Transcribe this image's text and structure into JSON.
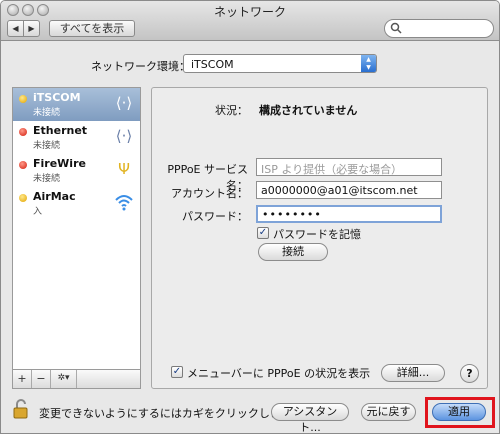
{
  "window": {
    "title": "ネットワーク"
  },
  "toolbar": {
    "back_label": "◀",
    "forward_label": "▶",
    "show_all_label": "すべてを表示"
  },
  "search": {
    "placeholder": ""
  },
  "location": {
    "label": "ネットワーク環境：",
    "value": "iTSCOM"
  },
  "sidebar": {
    "items": [
      {
        "name": "iTSCOM",
        "status": "未接続",
        "dot": "yellow",
        "icon": "pppoe-arrows-icon"
      },
      {
        "name": "Ethernet",
        "status": "未接続",
        "dot": "red",
        "icon": "ethernet-arrows-icon"
      },
      {
        "name": "FireWire",
        "status": "未接続",
        "dot": "red",
        "icon": "firewire-icon"
      },
      {
        "name": "AirMac",
        "status": "入",
        "dot": "yellow",
        "icon": "wifi-icon"
      }
    ],
    "tools": {
      "add": "+",
      "remove": "−",
      "action": "✲▾"
    }
  },
  "detail": {
    "status_label": "状況：",
    "status_value": "構成されていません",
    "pppoe_label": "PPPoE サービス名：",
    "pppoe_placeholder": "ISP より提供（必要な場合）",
    "account_label": "アカウント名：",
    "account_value": "a0000000@a01@itscom.net",
    "password_label": "パスワード：",
    "password_value": "••••••••",
    "remember_label": "パスワードを記憶",
    "remember_checked": true,
    "connect_label": "接続",
    "menubar_label": "メニューバーに PPPoE の状況を表示",
    "menubar_checked": true,
    "advanced_label": "詳細...",
    "help_label": "?"
  },
  "footer": {
    "lock_text": "変更できないようにするにはカギをクリックします。",
    "assistant_label": "アシスタント...",
    "revert_label": "元に戻す",
    "apply_label": "適用"
  },
  "colors": {
    "highlight": "#e0141c",
    "selection": "#8aa6c8",
    "accent": "#5c94e0"
  }
}
